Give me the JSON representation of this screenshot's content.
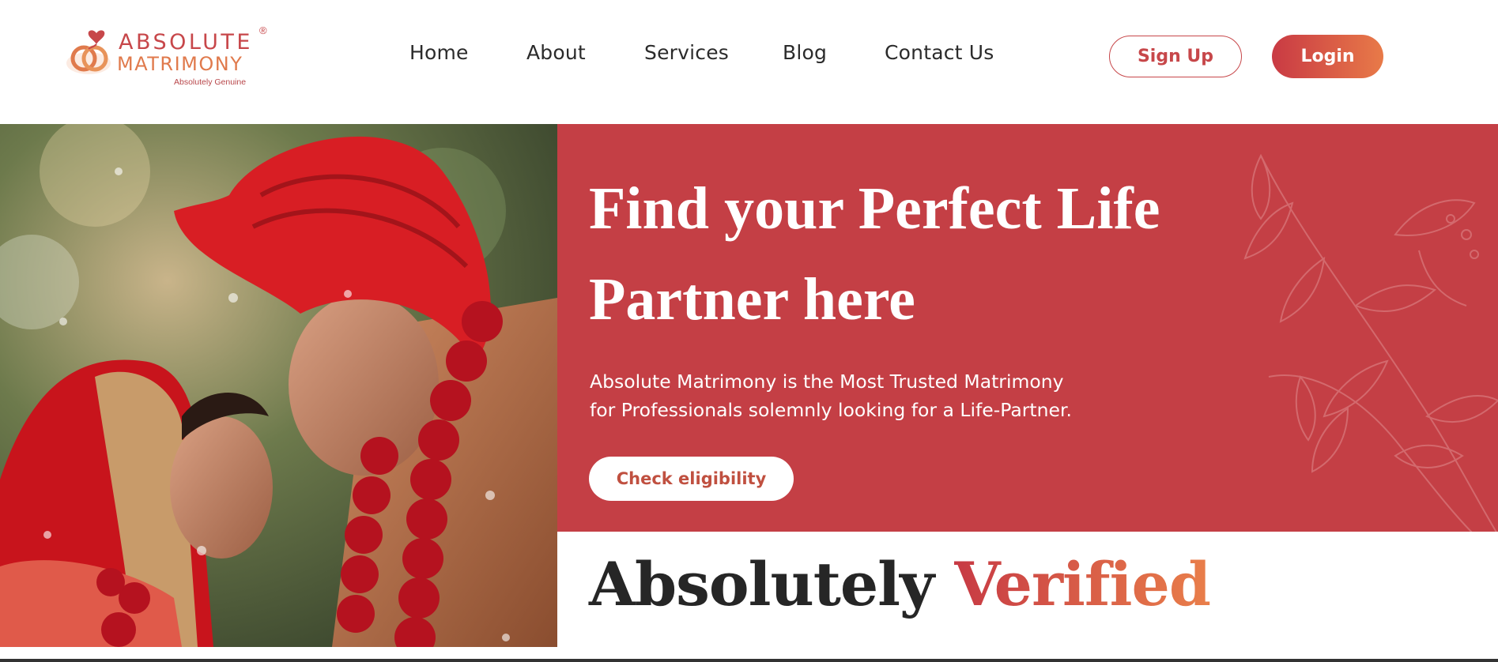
{
  "brand": {
    "name_line1": "ABSOLUTE",
    "name_line2": "MATRIMONY",
    "tagline": "Absolutely Genuine",
    "registered_mark": "®",
    "primary_color": "#c43f45",
    "accent_color": "#e87a48"
  },
  "nav": {
    "items": [
      {
        "label": "Home"
      },
      {
        "label": "About"
      },
      {
        "label": "Services"
      },
      {
        "label": "Blog"
      },
      {
        "label": "Contact Us"
      }
    ]
  },
  "auth": {
    "signup_label": "Sign Up",
    "login_label": "Login"
  },
  "hero": {
    "title_line1": "Find your Perfect Life",
    "title_line2": "Partner here",
    "desc_line1": "Absolute Matrimony is the Most Trusted Matrimony",
    "desc_line2": "for Professionals solemnly looking for a Life-Partner.",
    "cta_label": "Check eligibility",
    "photo_icon": "wedding-couple-photo"
  },
  "section": {
    "heading_dark": "Absolutely",
    "heading_accent": "Verified"
  }
}
